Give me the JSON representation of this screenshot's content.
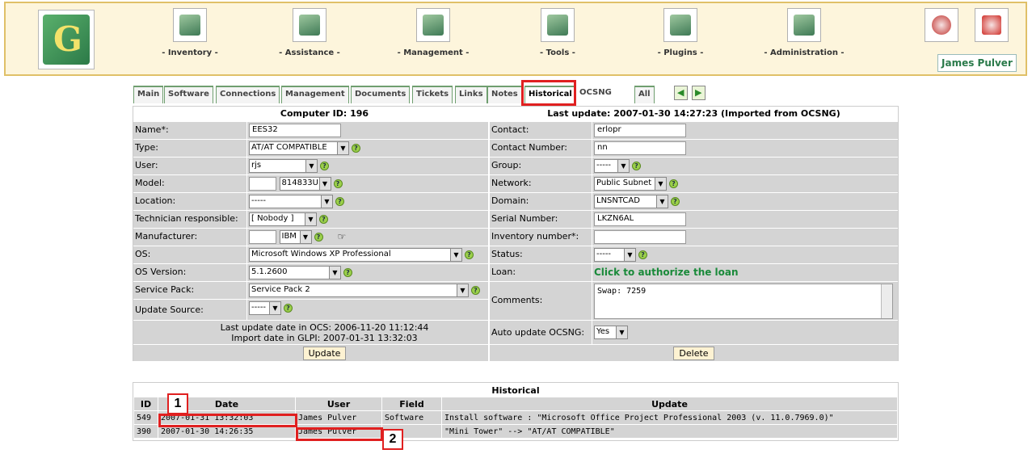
{
  "header": {
    "nav": [
      {
        "label": "- Inventory -",
        "icon": "inventory-icon"
      },
      {
        "label": "- Assistance -",
        "icon": "assistance-icon"
      },
      {
        "label": "- Management -",
        "icon": "management-icon"
      },
      {
        "label": "- Tools -",
        "icon": "tools-icon"
      },
      {
        "label": "- Plugins -",
        "icon": "plugins-icon"
      },
      {
        "label": "- Administration -",
        "icon": "administration-icon"
      }
    ],
    "user": "James Pulver"
  },
  "tabs": [
    "Main",
    "Software",
    "Connections",
    "Management",
    "Documents",
    "Tickets",
    "Links",
    "Notes",
    "Historical",
    "OCSNG",
    "All"
  ],
  "active_tab": "Historical",
  "form": {
    "left_title": "Computer ID: 196",
    "right_title": "Last update: 2007-01-30 14:27:23   (Imported from OCSNG)",
    "name_label": "Name*:",
    "name_value": "EES32",
    "type_label": "Type:",
    "type_value": "AT/AT COMPATIBLE",
    "user_label": "User:",
    "user_value": "rjs",
    "model_label": "Model:",
    "model_value": "814833U",
    "location_label": "Location:",
    "location_value": "-----",
    "tech_label": "Technician responsible:",
    "tech_value": "[ Nobody ]",
    "manufacturer_label": "Manufacturer:",
    "manufacturer_value": "IBM",
    "os_label": "OS:",
    "os_value": "Microsoft Windows XP Professional",
    "osver_label": "OS Version:",
    "osver_value": "5.1.2600",
    "sp_label": "Service Pack:",
    "sp_value": "Service Pack 2",
    "updsrc_label": "Update Source:",
    "updsrc_value": "-----",
    "last_ocs": "Last update date in OCS: 2006-11-20 11:12:44",
    "import_date": "Import date in GLPI: 2007-01-31 13:32:03",
    "update_button": "Update",
    "contact_label": "Contact:",
    "contact_value": "erlopr",
    "contactnum_label": "Contact Number:",
    "contactnum_value": "nn",
    "group_label": "Group:",
    "group_value": "-----",
    "network_label": "Network:",
    "network_value": "Public Subnet",
    "domain_label": "Domain:",
    "domain_value": "LNSNTCAD",
    "serial_label": "Serial Number:",
    "serial_value": "LKZN6AL",
    "invnum_label": "Inventory number*:",
    "invnum_value": "",
    "status_label": "Status:",
    "status_value": "-----",
    "loan_label": "Loan:",
    "loan_link": "Click to authorize the loan",
    "comments_label": "Comments:",
    "comments_value": "Swap: 7259",
    "autoupd_label": "Auto update OCSNG:",
    "autoupd_value": "Yes",
    "delete_button": "Delete"
  },
  "historical": {
    "caption": "Historical",
    "columns": [
      "ID",
      "Date",
      "User",
      "Field",
      "Update"
    ],
    "rows": [
      {
        "id": "549",
        "date": "2007-01-31 13:32:03",
        "user": "James Pulver",
        "field": "Software",
        "update": "Install software : \"Microsoft Office Project Professional 2003 (v. 11.0.7969.0)\""
      },
      {
        "id": "390",
        "date": "2007-01-30 14:26:35",
        "user": "James Pulver",
        "field": "",
        "update": "\"Mini Tower\" --> \"AT/AT COMPATIBLE\""
      }
    ]
  },
  "callouts": [
    "1",
    "2"
  ],
  "colors": {
    "accent_green": "#2a7a4a",
    "highlight_red": "#e02020",
    "header_bg": "#fdf5dc"
  }
}
